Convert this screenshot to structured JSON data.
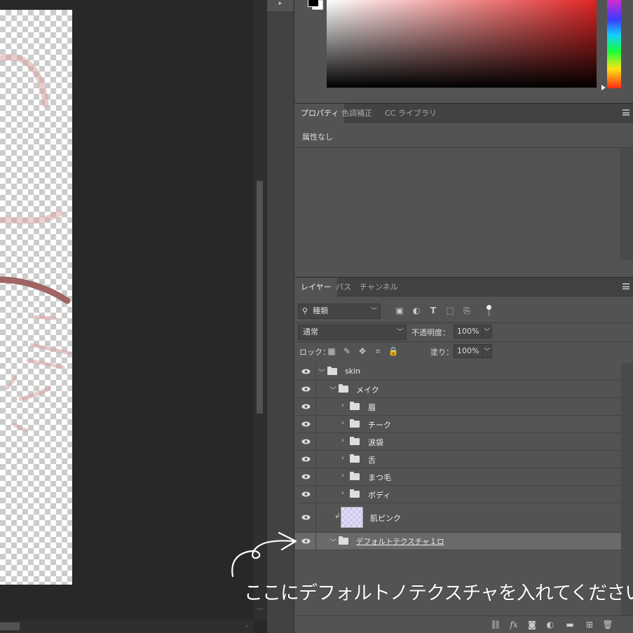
{
  "properties_panel": {
    "tabs": [
      {
        "label": "プロパティ",
        "active": true
      },
      {
        "label": "色調補正",
        "active": false
      },
      {
        "label": "CC ライブラリ",
        "active": false
      }
    ],
    "body_text": "属性なし"
  },
  "layers_panel": {
    "tabs": [
      {
        "label": "レイヤー",
        "active": true
      },
      {
        "label": "パス",
        "active": false
      },
      {
        "label": "チャンネル",
        "active": false
      }
    ],
    "filter_kind": "種類",
    "blend_mode": "通常",
    "opacity_label": "不透明度：",
    "opacity_value": "100%",
    "lock_label": "ロック：",
    "fill_label": "塗り：",
    "fill_value": "100%",
    "layers": [
      {
        "name": "skin",
        "type": "group",
        "expanded": true,
        "depth": 0
      },
      {
        "name": "メイク",
        "type": "group",
        "expanded": true,
        "depth": 1
      },
      {
        "name": "眉",
        "type": "group",
        "expanded": false,
        "depth": 2
      },
      {
        "name": "チーク",
        "type": "group",
        "expanded": false,
        "depth": 2
      },
      {
        "name": "涙袋",
        "type": "group",
        "expanded": false,
        "depth": 2
      },
      {
        "name": "舌",
        "type": "group",
        "expanded": false,
        "depth": 2
      },
      {
        "name": "まつ毛",
        "type": "group",
        "expanded": false,
        "depth": 2
      },
      {
        "name": "ボディ",
        "type": "group",
        "expanded": false,
        "depth": 2
      },
      {
        "name": "肌ピンク",
        "type": "layer",
        "clipped": true,
        "depth": 1
      },
      {
        "name": "デフォルトテクスチャ１ロ",
        "type": "group",
        "expanded": true,
        "depth": 1,
        "selected": true
      }
    ]
  },
  "annotation": {
    "text": "ここにデフォルトノテクスチャを入れてください"
  },
  "colors": {
    "panel_bg": "#535353",
    "panel_header": "#424242",
    "canvas_bg": "#282828",
    "selected_row": "#6a6a6a",
    "text": "#eeeeee"
  }
}
